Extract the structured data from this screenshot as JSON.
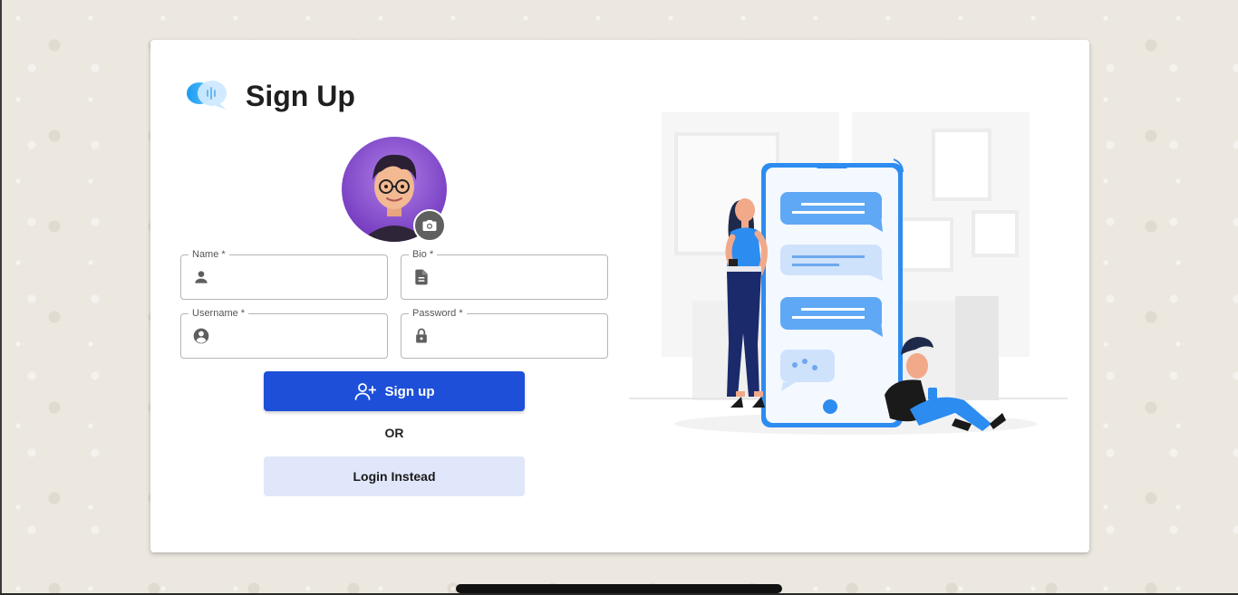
{
  "page": {
    "title": "Sign Up"
  },
  "colors": {
    "primary": "#1e4fd8",
    "secondary_bg": "#e1e7fa",
    "chat_blue": "#2d8cf0"
  },
  "form": {
    "name_label": "Name *",
    "bio_label": "Bio *",
    "username_label": "Username *",
    "password_label": "Password *",
    "name_value": "",
    "bio_value": "",
    "username_value": "",
    "password_value": ""
  },
  "icons": {
    "logo": "chat-bubbles-logo",
    "avatar_upload": "camera-icon",
    "name": "person-icon",
    "bio": "document-icon",
    "username": "account-circle-icon",
    "password": "lock-icon",
    "signup": "person-add-icon"
  },
  "actions": {
    "signup_label": "Sign up",
    "or_label": "OR",
    "login_label": "Login Instead"
  }
}
